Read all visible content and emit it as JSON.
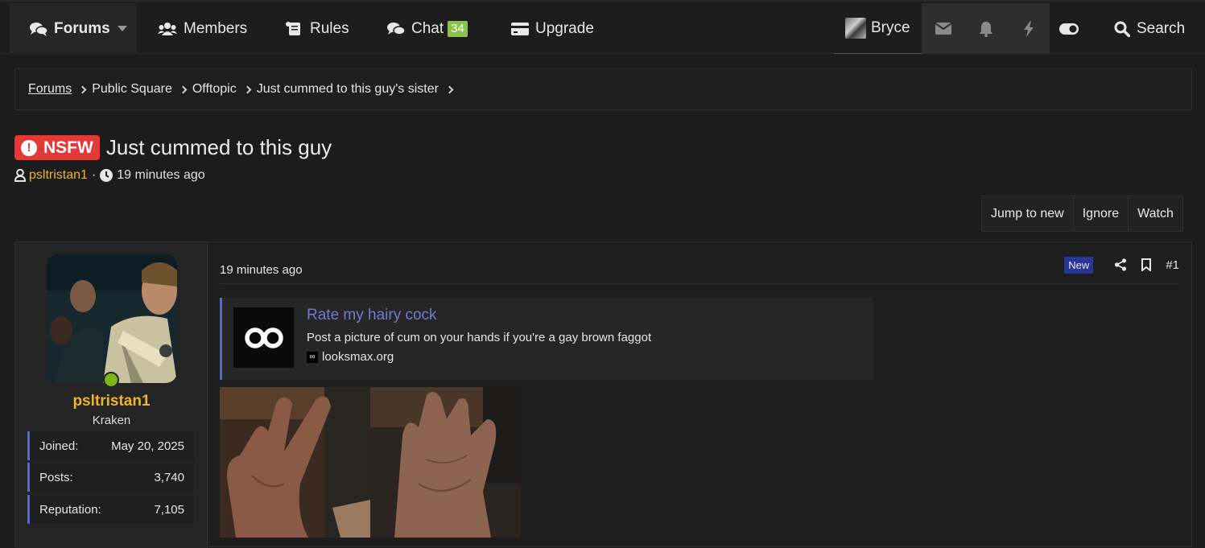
{
  "nav": {
    "forums": "Forums",
    "members": "Members",
    "rules": "Rules",
    "chat": "Chat",
    "chat_badge": "34",
    "upgrade": "Upgrade",
    "user": "Bryce",
    "search": "Search"
  },
  "breadcrumb": [
    "Forums",
    "Public Square",
    "Offtopic",
    "Just cummed to this guy's sister"
  ],
  "thread": {
    "prefix": "NSFW",
    "title": "Just cummed to this guy",
    "author": "psltristan1",
    "time": "19 minutes ago"
  },
  "actions": [
    "Jump to new",
    "Ignore",
    "Watch"
  ],
  "post": {
    "time": "19 minutes ago",
    "new_badge": "New",
    "number": "#1",
    "user": {
      "name": "psltristan1",
      "title": "Kraken",
      "stats": [
        {
          "label": "Joined:",
          "value": "May 20, 2025"
        },
        {
          "label": "Posts:",
          "value": "3,740"
        },
        {
          "label": "Reputation:",
          "value": "7,105"
        }
      ]
    },
    "embed": {
      "title": "Rate my hairy cock",
      "description": "Post a picture of cum on your hands if you're a gay brown faggot",
      "site": "looksmax.org"
    }
  },
  "colors": {
    "accent": "#5c6bc0",
    "username": "#f0b429",
    "nsfw": "#e53935",
    "chat_badge": "#8bc34a",
    "online": "#7cb518"
  }
}
